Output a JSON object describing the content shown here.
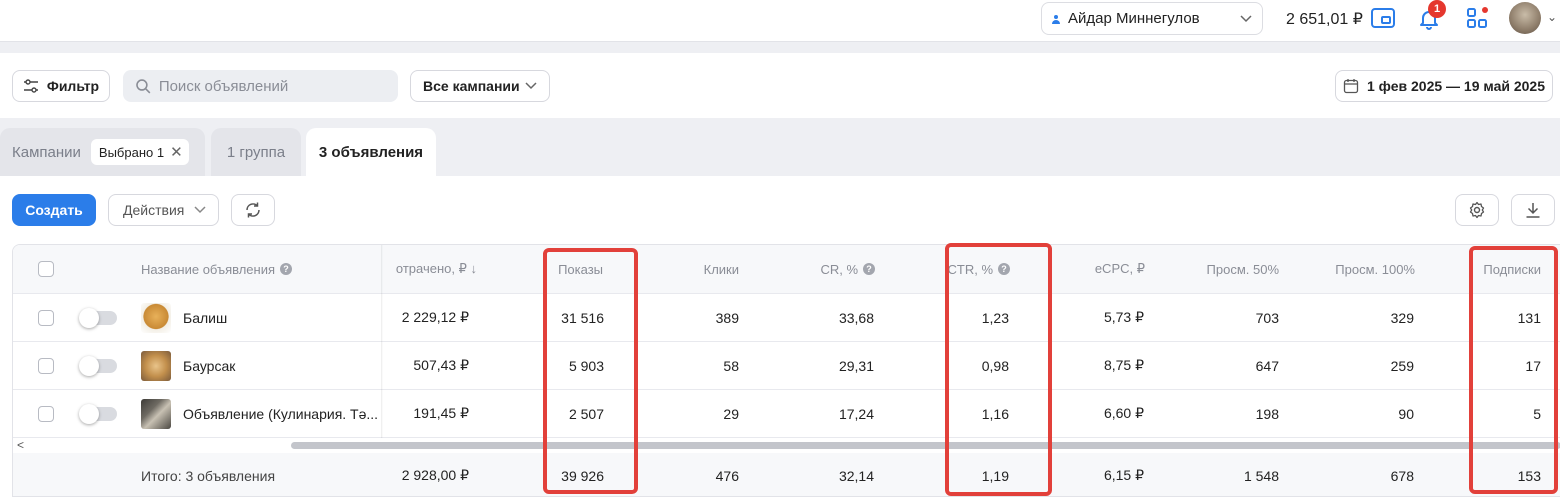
{
  "topbar": {
    "user_name": "Айдар Миннегулов",
    "balance": "2 651,01 ₽",
    "notifications_count": "1"
  },
  "filterbar": {
    "filter_label": "Фильтр",
    "search_placeholder": "Поиск объявлений",
    "campaigns_select": "Все кампании",
    "date_range": "1 фев 2025 — 19 май 2025"
  },
  "tabs": {
    "campaigns_label": "Кампании",
    "campaigns_chip": "Выбрано 1",
    "group_label": "1 группа",
    "ads_label": "3 объявления"
  },
  "toolbar": {
    "create_label": "Создать",
    "actions_label": "Действия"
  },
  "table": {
    "headers": {
      "name": "Название объявления",
      "spent": "отрачено, ₽ ↓",
      "impressions": "Показы",
      "clicks": "Клики",
      "cr": "CR, %",
      "ctr": "CTR, %",
      "ecpc": "eCPC, ₽",
      "views50": "Просм. 50%",
      "views100": "Просм. 100%",
      "subscriptions": "Подписки"
    },
    "rows": [
      {
        "name": "Балиш",
        "spent": "2 229,12 ₽",
        "impressions": "31 516",
        "clicks": "389",
        "cr": "33,68",
        "ctr": "1,23",
        "ecpc": "5,73 ₽",
        "views50": "703",
        "views100": "329",
        "subscriptions": "131"
      },
      {
        "name": "Баурсак",
        "spent": "507,43 ₽",
        "impressions": "5 903",
        "clicks": "58",
        "cr": "29,31",
        "ctr": "0,98",
        "ecpc": "8,75 ₽",
        "views50": "647",
        "views100": "259",
        "subscriptions": "17"
      },
      {
        "name": "Объявление (Кулинария. Тә...",
        "spent": "191,45 ₽",
        "impressions": "2 507",
        "clicks": "29",
        "cr": "17,24",
        "ctr": "1,16",
        "ecpc": "6,60 ₽",
        "views50": "198",
        "views100": "90",
        "subscriptions": "5"
      }
    ],
    "total": {
      "name": "Итого: 3 объявления",
      "spent": "2 928,00 ₽",
      "impressions": "39 926",
      "clicks": "476",
      "cr": "32,14",
      "ctr": "1,19",
      "ecpc": "6,15 ₽",
      "views50": "1 548",
      "views100": "678",
      "subscriptions": "153"
    }
  },
  "colors": {
    "accent": "#2b7de9",
    "highlight": "#e2403a",
    "badge": "#e5372e"
  },
  "icons": [
    "person-icon",
    "chevron-down-icon",
    "wallet-icon",
    "bell-icon",
    "apps-icon",
    "filter-sliders-icon",
    "search-icon",
    "calendar-icon",
    "close-icon",
    "refresh-icon",
    "gear-icon",
    "download-icon",
    "help-icon"
  ]
}
